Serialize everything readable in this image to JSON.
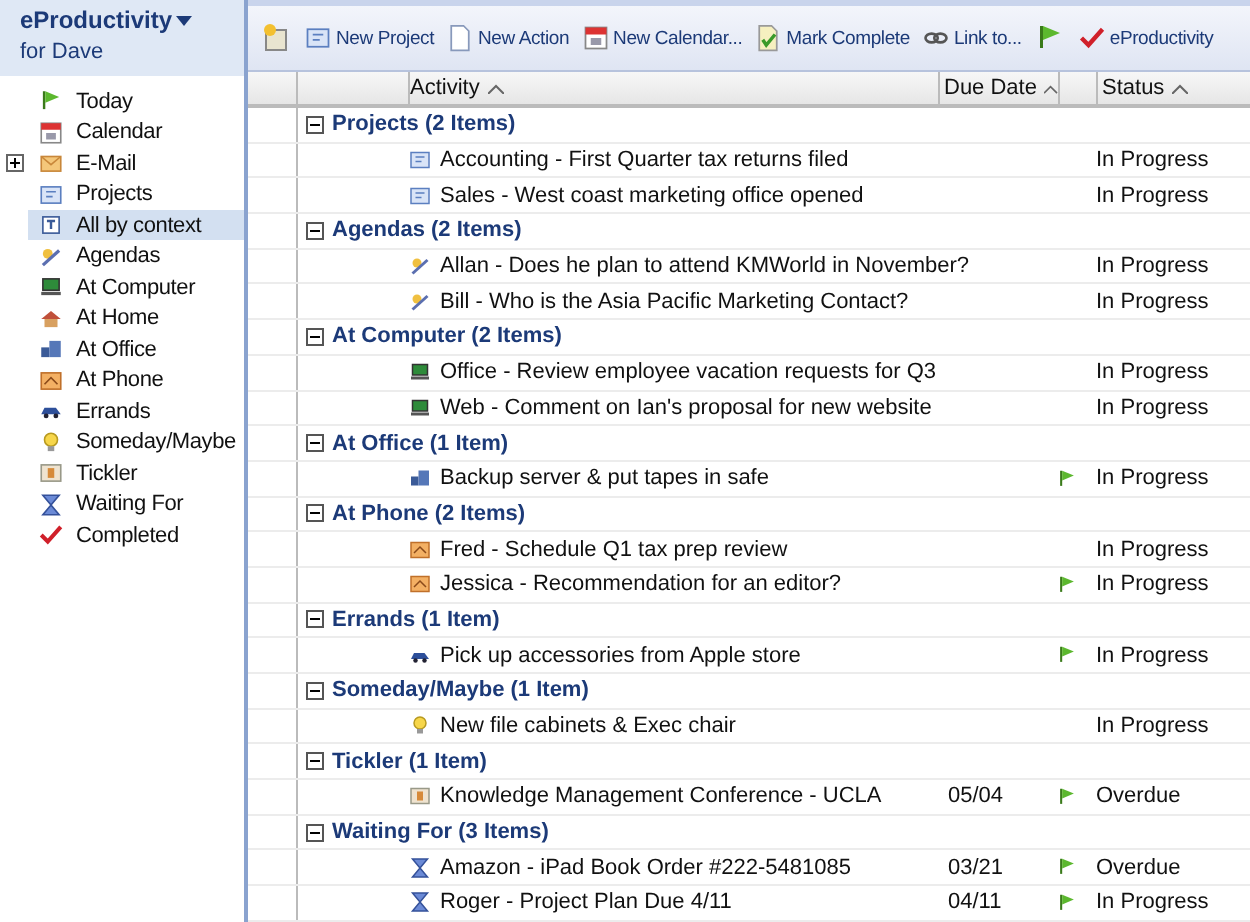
{
  "sidebar": {
    "title": "eProductivity",
    "subtitle": "for Dave",
    "items": [
      {
        "label": "Today",
        "kind": "flag",
        "selected": false
      },
      {
        "label": "Calendar",
        "kind": "calendar",
        "selected": false
      },
      {
        "label": "E-Mail",
        "kind": "email",
        "selected": false,
        "expanded": false
      },
      {
        "label": "Projects",
        "kind": "project",
        "selected": false
      },
      {
        "label": "All by context",
        "kind": "context",
        "selected": true
      },
      {
        "label": "Agendas",
        "kind": "agenda",
        "selected": false
      },
      {
        "label": "At Computer",
        "kind": "computer",
        "selected": false
      },
      {
        "label": "At Home",
        "kind": "home",
        "selected": false
      },
      {
        "label": "At Office",
        "kind": "office",
        "selected": false
      },
      {
        "label": "At Phone",
        "kind": "phone",
        "selected": false
      },
      {
        "label": "Errands",
        "kind": "car",
        "selected": false
      },
      {
        "label": "Someday/Maybe",
        "kind": "bulb",
        "selected": false
      },
      {
        "label": "Tickler",
        "kind": "tickler",
        "selected": false
      },
      {
        "label": "Waiting For",
        "kind": "hourglass",
        "selected": false
      },
      {
        "label": "Completed",
        "kind": "check",
        "selected": false
      }
    ]
  },
  "toolbar": [
    {
      "kind": "new-doc"
    },
    {
      "kind": "project",
      "label": "New Project"
    },
    {
      "kind": "action",
      "label": "New Action"
    },
    {
      "kind": "calendar",
      "label": "New Calendar..."
    },
    {
      "kind": "complete",
      "label": "Mark Complete"
    },
    {
      "kind": "link",
      "label": "Link to..."
    },
    {
      "kind": "flag"
    },
    {
      "kind": "check",
      "label": "eProductivity"
    }
  ],
  "table": {
    "columns": [
      "Activity",
      "Due Date",
      "Status"
    ],
    "groups": [
      {
        "title": "Projects (2 Items)",
        "expanded": true,
        "rows": [
          {
            "kind": "project",
            "activity": "Accounting - First Quarter tax returns filed",
            "flagged": false,
            "status": "In Progress"
          },
          {
            "kind": "project",
            "activity": "Sales - West coast marketing office opened",
            "flagged": false,
            "status": "In Progress"
          }
        ]
      },
      {
        "title": "Agendas (2 Items)",
        "expanded": true,
        "rows": [
          {
            "kind": "agenda",
            "activity": "Allan - Does he plan to attend KMWorld in November?",
            "flagged": false,
            "status": "In Progress"
          },
          {
            "kind": "agenda",
            "activity": "Bill - Who is the Asia Pacific Marketing Contact?",
            "flagged": false,
            "status": "In Progress"
          }
        ]
      },
      {
        "title": "At Computer (2 Items)",
        "expanded": true,
        "rows": [
          {
            "kind": "computer",
            "activity": "Office - Review employee vacation requests for Q3",
            "flagged": false,
            "status": "In Progress"
          },
          {
            "kind": "computer",
            "activity": "Web - Comment on Ian's proposal for new website",
            "flagged": false,
            "status": "In Progress"
          }
        ]
      },
      {
        "title": "At Office (1 Item)",
        "expanded": true,
        "rows": [
          {
            "kind": "office",
            "activity": "Backup server & put tapes in safe",
            "flagged": true,
            "status": "In Progress"
          }
        ]
      },
      {
        "title": "At Phone (2 Items)",
        "expanded": true,
        "rows": [
          {
            "kind": "phone",
            "activity": "Fred - Schedule Q1 tax prep review",
            "flagged": false,
            "status": "In Progress"
          },
          {
            "kind": "phone",
            "activity": "Jessica - Recommendation for an editor?",
            "flagged": true,
            "status": "In Progress"
          }
        ]
      },
      {
        "title": "Errands (1 Item)",
        "expanded": true,
        "rows": [
          {
            "kind": "car",
            "activity": "Pick up accessories from Apple store",
            "flagged": true,
            "status": "In Progress"
          }
        ]
      },
      {
        "title": "Someday/Maybe (1 Item)",
        "expanded": true,
        "rows": [
          {
            "kind": "bulb",
            "activity": "New file cabinets & Exec chair",
            "flagged": false,
            "status": "In Progress"
          }
        ]
      },
      {
        "title": "Tickler (1 Item)",
        "expanded": true,
        "rows": [
          {
            "kind": "tickler",
            "activity": "Knowledge Management Conference - UCLA",
            "due": "05/04",
            "flagged": true,
            "status": "Overdue"
          }
        ]
      },
      {
        "title": "Waiting For (3 Items)",
        "expanded": true,
        "rows": [
          {
            "kind": "hourglass",
            "activity": "Amazon - iPad Book Order #222-5481085",
            "due": "03/21",
            "flagged": true,
            "status": "Overdue"
          },
          {
            "kind": "hourglass",
            "activity": "Roger - Project Plan Due 4/11",
            "due": "04/11",
            "flagged": true,
            "status": "In Progress"
          }
        ]
      }
    ]
  }
}
